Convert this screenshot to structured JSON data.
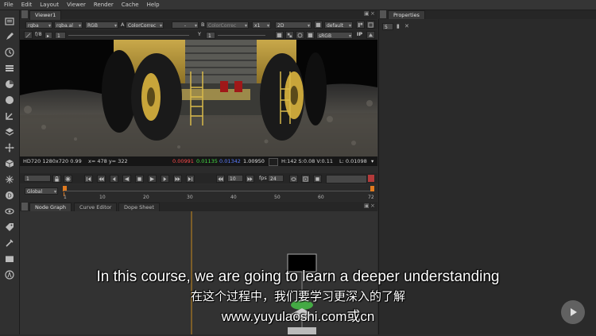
{
  "menu": [
    "File",
    "Edit",
    "Layout",
    "Viewer",
    "Render",
    "Cache",
    "Help"
  ],
  "viewer": {
    "tab_label": "Viewer1",
    "row1": {
      "channels": "rgba",
      "alpha": "rgba.al",
      "colorspace": "RGB",
      "a_label": "A",
      "a_input": "ColorCorrec",
      "dash": "-",
      "b_label": "B",
      "b_input": "ColorCorrec",
      "zoom": "x1",
      "mode": "2D",
      "lut": "default"
    },
    "row2": {
      "fstop_label": "f/8",
      "exposure": "1",
      "y_label": "Y",
      "gamma": "1",
      "display": "sRGB"
    },
    "info": {
      "format": "HD720 1280x720 0.99",
      "coords": "x= 478 y= 322",
      "r": "0.00991",
      "g": "0.01135",
      "b": "0.01342",
      "a": "1.00950",
      "hsv": "H:142 S:0.08 V:0.11",
      "lum": "L: 0.01098"
    },
    "colors": {
      "r": "#ff4a4a",
      "g": "#44dd44",
      "b": "#5a7cff"
    }
  },
  "playback": {
    "current_frame": "1",
    "step": "10",
    "fps_label": "fps",
    "fps": "24",
    "range_mode": "Global",
    "ticks": [
      "1",
      "10",
      "20",
      "30",
      "40",
      "50",
      "60",
      "72"
    ],
    "current_marker": "1"
  },
  "node_tabs": [
    "Node Graph",
    "Curve Editor",
    "Dope Sheet"
  ],
  "properties": {
    "tab_label": "Properties",
    "max_panels": "5"
  },
  "subtitles": {
    "english": "In this course, we are going to learn a deeper understanding",
    "chinese": "在这个过程中，我们要学习更深入的了解",
    "url": "www.yuyulaoshi.com或cn"
  },
  "toolbar_icons": [
    "image-icon",
    "paint-icon",
    "time-icon",
    "channel-icon",
    "color-icon",
    "filter-icon",
    "keyer-icon",
    "merge-icon",
    "transform-icon",
    "3d-icon",
    "particles-icon",
    "deep-icon",
    "views-icon",
    "metadata-icon",
    "toolsets-icon",
    "other-icon",
    "furnace-icon"
  ]
}
